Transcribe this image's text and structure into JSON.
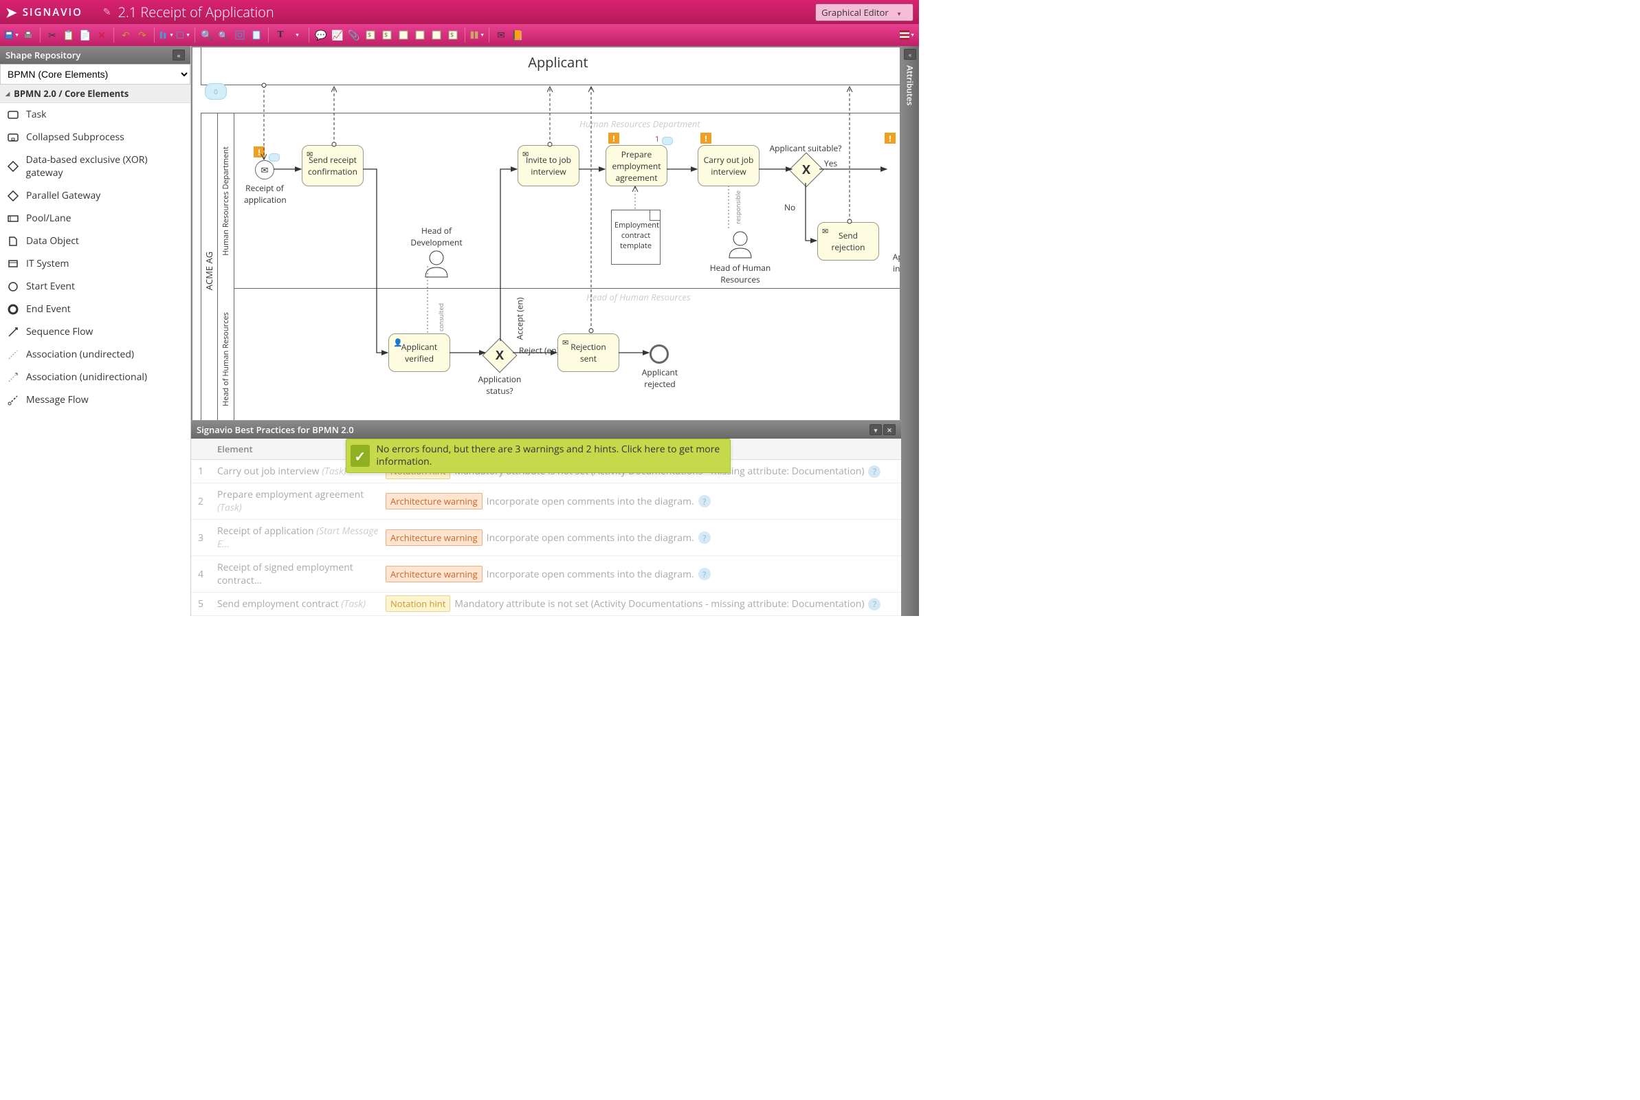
{
  "app": {
    "name": "SIGNAVIO",
    "doc_title": "2.1 Receipt of Application",
    "editor_mode": "Graphical Editor"
  },
  "left": {
    "title": "Shape Repository",
    "stencil_set": "BPMN (Core Elements)",
    "category": "BPMN 2.0 / Core Elements",
    "shapes": [
      {
        "id": "task",
        "label": "Task"
      },
      {
        "id": "subprocess",
        "label": "Collapsed Subprocess"
      },
      {
        "id": "xor",
        "label": "Data-based exclusive (XOR) gateway"
      },
      {
        "id": "parallel",
        "label": "Parallel Gateway"
      },
      {
        "id": "pool",
        "label": "Pool/Lane"
      },
      {
        "id": "dataobj",
        "label": "Data Object"
      },
      {
        "id": "itsystem",
        "label": "IT System"
      },
      {
        "id": "start",
        "label": "Start Event"
      },
      {
        "id": "end",
        "label": "End Event"
      },
      {
        "id": "seqflow",
        "label": "Sequence Flow"
      },
      {
        "id": "assoc",
        "label": "Association (undirected)"
      },
      {
        "id": "assocdir",
        "label": "Association (unidirectional)"
      },
      {
        "id": "msgflow",
        "label": "Message Flow"
      }
    ]
  },
  "right": {
    "title": "Attributes"
  },
  "diagram": {
    "pool_applicant": "Applicant",
    "pool_acme": "ACME AG",
    "lane_hr": "Human Resources Department",
    "lane_head": "Head of Human Resources",
    "watermark_hr": "Human Resources Department",
    "watermark_head": "Head of Human Resources",
    "start": "Receipt of application",
    "t_confirm": "Send receipt confirmation",
    "t_invite": "Invite to job interview",
    "t_prepare": "Prepare employment agreement",
    "t_carryout": "Carry out job interview",
    "t_reject": "Send rejection",
    "t_verified": "Applicant verified",
    "t_rejectsent": "Rejection sent",
    "g_status": "Application status?",
    "g_suitable": "Applicant suitable?",
    "g_yes": "Yes",
    "g_no": "No",
    "g_reject": "Reject (en)",
    "g_accept": "Accept (en)",
    "end_rejected": "Applicant rejected",
    "end_informed": "Applicant informed",
    "doc_template": "Employment contract template",
    "p_headdev": "Head of Development",
    "p_headhr": "Head of Human Resources",
    "assoc_consulted": "consulted",
    "assoc_responsible": "responsible",
    "comment_count": "0",
    "prepare_marker": "1"
  },
  "bp": {
    "title": "Signavio Best Practices for BPMN 2.0",
    "col_element": "Element",
    "notif": "No errors found, but there are 3 warnings and 2 hints. Click here to get more information.",
    "rows": [
      {
        "n": "1",
        "el": "Carry out job interview",
        "type": "(Task)",
        "badge": "Notation hint",
        "badge_cls": "badge-hint",
        "msg": "Mandatory attribute is not set (Activity Documentations - missing attribute: Documentation)"
      },
      {
        "n": "2",
        "el": "Prepare employment agreement",
        "type": "(Task)",
        "badge": "Architecture warning",
        "badge_cls": "badge-warn",
        "msg": "Incorporate open comments into the diagram."
      },
      {
        "n": "3",
        "el": "Receipt of application",
        "type": "(Start Message E...",
        "badge": "Architecture warning",
        "badge_cls": "badge-warn",
        "msg": "Incorporate open comments into the diagram."
      },
      {
        "n": "4",
        "el": "Receipt of signed employment contract...",
        "type": "",
        "badge": "Architecture warning",
        "badge_cls": "badge-warn",
        "msg": "Incorporate open comments into the diagram."
      },
      {
        "n": "5",
        "el": "Send employment contract",
        "type": "(Task)",
        "badge": "Notation hint",
        "badge_cls": "badge-hint",
        "msg": "Mandatory attribute is not set (Activity Documentations - missing attribute: Documentation)"
      }
    ]
  }
}
